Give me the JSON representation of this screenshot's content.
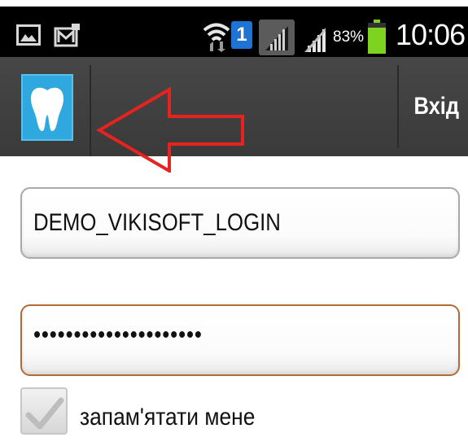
{
  "status_bar": {
    "icons": [
      "gallery-icon",
      "mail-icon",
      "wifi-icon",
      "sim-icon",
      "signal-icon",
      "signal-icon",
      "battery-icon"
    ],
    "sim_number": "1",
    "battery_percent": "83%",
    "time": "10:06"
  },
  "action_bar": {
    "logo_icon": "tooth-icon",
    "annotation": "red-arrow-icon",
    "login_label": "Вхід"
  },
  "form": {
    "login_value": "DEMO_VIKISOFT_LOGIN",
    "password_value": "•••••••••••••••••••••",
    "remember_label": "запам'ятати мене",
    "remember_checked": false
  },
  "colors": {
    "action_bar": "#404040",
    "logo_background": "#2ea8df",
    "annotation_arrow": "#e8231f",
    "status_bar": "#000000"
  }
}
